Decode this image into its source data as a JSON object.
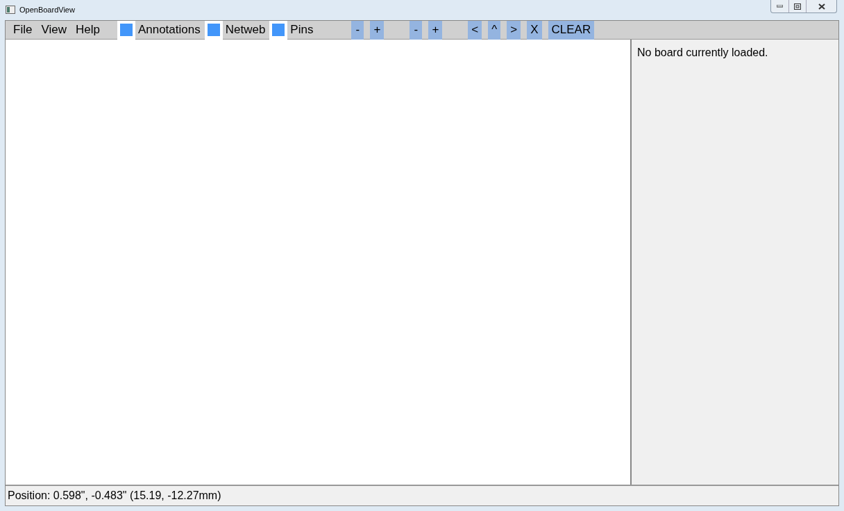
{
  "window": {
    "title": "OpenBoardView"
  },
  "menu": [
    "File",
    "View",
    "Help"
  ],
  "toggles": [
    {
      "label": "Annotations",
      "checked": true
    },
    {
      "label": "Netweb",
      "checked": true
    },
    {
      "label": "Pins",
      "checked": true
    }
  ],
  "button_groups": [
    [
      "-",
      "+"
    ],
    [
      "-",
      "+"
    ],
    [
      "<",
      "^",
      ">",
      "X",
      "CLEAR"
    ]
  ],
  "side_panel": {
    "message": "No board currently loaded."
  },
  "status_bar": "Position: 0.598\", -0.483\" (15.19, -12.27mm)"
}
